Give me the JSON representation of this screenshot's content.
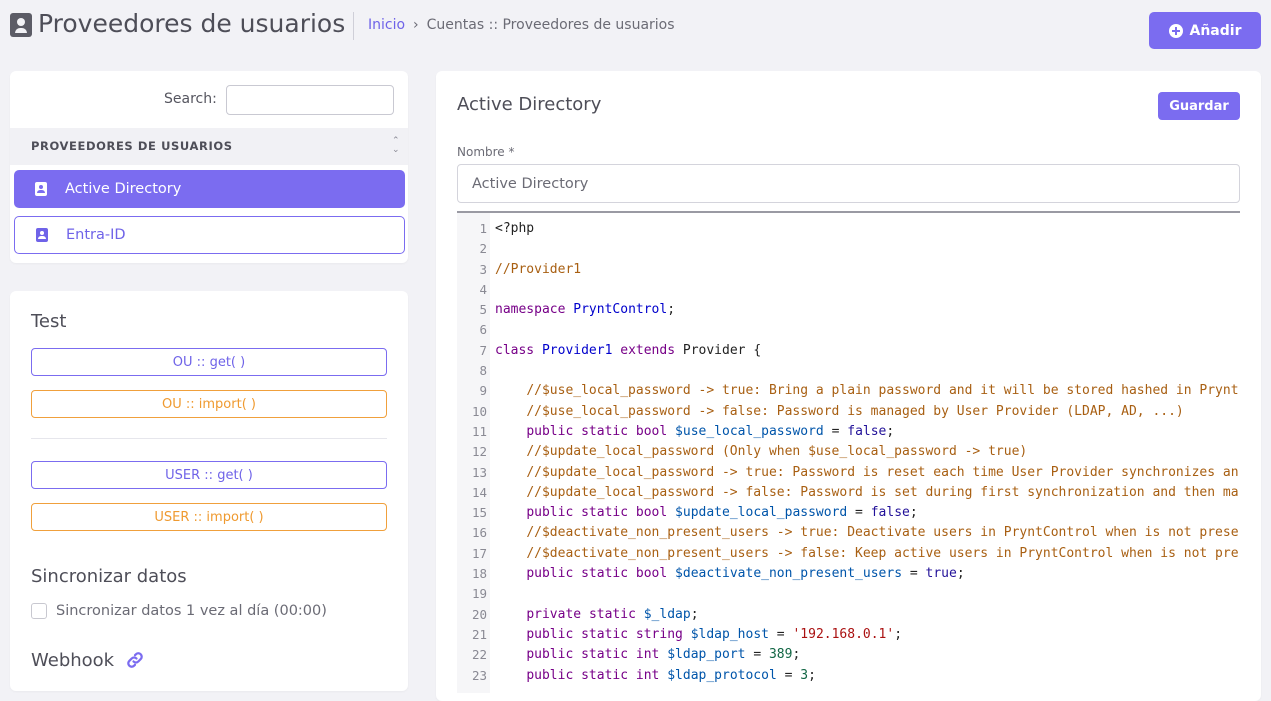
{
  "header": {
    "title": "Proveedores de usuarios",
    "breadcrumb_home": "Inicio",
    "breadcrumb_sep": "›",
    "breadcrumb_current": "Cuentas :: Proveedores de usuarios",
    "add_button": "Añadir",
    "icon": "address-book-icon"
  },
  "sidebar": {
    "search_label": "Search:",
    "search_value": "",
    "list_header": "PROVEEDORES DE USUARIOS",
    "items": [
      {
        "label": "Active Directory",
        "active": true
      },
      {
        "label": "Entra-ID",
        "active": false
      }
    ]
  },
  "test": {
    "title": "Test",
    "buttons": [
      "OU :: get( )",
      "OU :: import( )",
      "USER :: get( )",
      "USER :: import( )"
    ]
  },
  "sync": {
    "title": "Sincronizar datos",
    "checkbox_label": "Sincronizar datos 1 vez al día (00:00)",
    "checked": false
  },
  "webhook": {
    "title": "Webhook",
    "icon": "link-icon"
  },
  "editor": {
    "title": "Active Directory",
    "save_button": "Guardar",
    "name_label": "Nombre *",
    "name_value": "Active Directory",
    "code": [
      "<?php",
      "",
      "//Provider1",
      "",
      "namespace PryntControl;",
      "",
      "class Provider1 extends Provider {",
      "",
      "    //$use_local_password -> true: Bring a plain password and it will be stored hashed in Prynt",
      "    //$use_local_password -> false: Password is managed by User Provider (LDAP, AD, ...)",
      "    public static bool $use_local_password = false;",
      "    //$update_local_password (Only when $use_local_password -> true)",
      "    //$update_local_password -> true: Password is reset each time User Provider synchronizes an",
      "    //$update_local_password -> false: Password is set during first synchronization and then ma",
      "    public static bool $update_local_password = false;",
      "    //$deactivate_non_present_users -> true: Deactivate users in PryntControl when is not prese",
      "    //$deactivate_non_present_users -> false: Keep active users in PryntControl when is not pre",
      "    public static bool $deactivate_non_present_users = true;",
      "",
      "    private static $_ldap;",
      "    public static string $ldap_host = '192.168.0.1';",
      "    public static int $ldap_port = 389;",
      "    public static int $ldap_protocol = 3;"
    ]
  },
  "colors": {
    "accent": "#7b6cf0",
    "orange": "#f0a03c",
    "background": "#f2f2f6"
  }
}
